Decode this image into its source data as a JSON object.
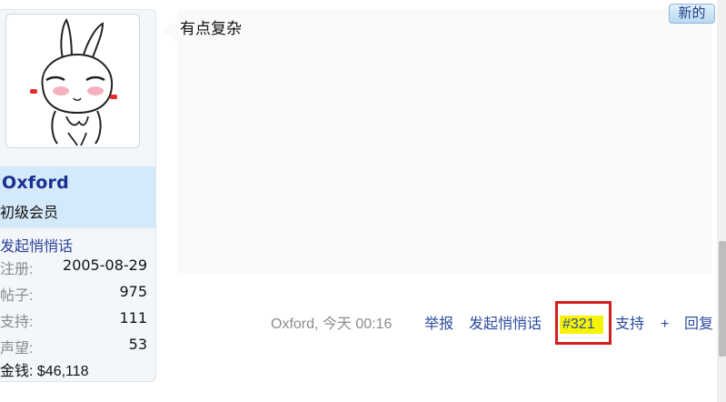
{
  "user": {
    "username": "Oxford",
    "title": "初级会员",
    "pm_link": "发起悄悄话",
    "stats": [
      {
        "label": "注册:",
        "value": "2005-08-29"
      },
      {
        "label": "帖子:",
        "value": "975"
      },
      {
        "label": "支持:",
        "value": "111"
      },
      {
        "label": "声望:",
        "value": "53"
      }
    ],
    "money_label": "金钱:",
    "money_value": "$46,118",
    "avatar_icon": "rabbit-avatar-icon"
  },
  "post": {
    "text": "有点复杂",
    "new_badge": "新的"
  },
  "footer": {
    "author": "Oxford",
    "time": "今天 00:16",
    "report": "举报",
    "send_pm": "发起悄悄话",
    "post_number": "#321",
    "like": "支持",
    "plus": "+",
    "reply": "回复"
  },
  "colors": {
    "link": "#2b4a9e",
    "username": "#1b2f8f",
    "name_panel": "#d4e9f9",
    "highlight": "#f6f400",
    "annotation_box": "#d22020"
  }
}
